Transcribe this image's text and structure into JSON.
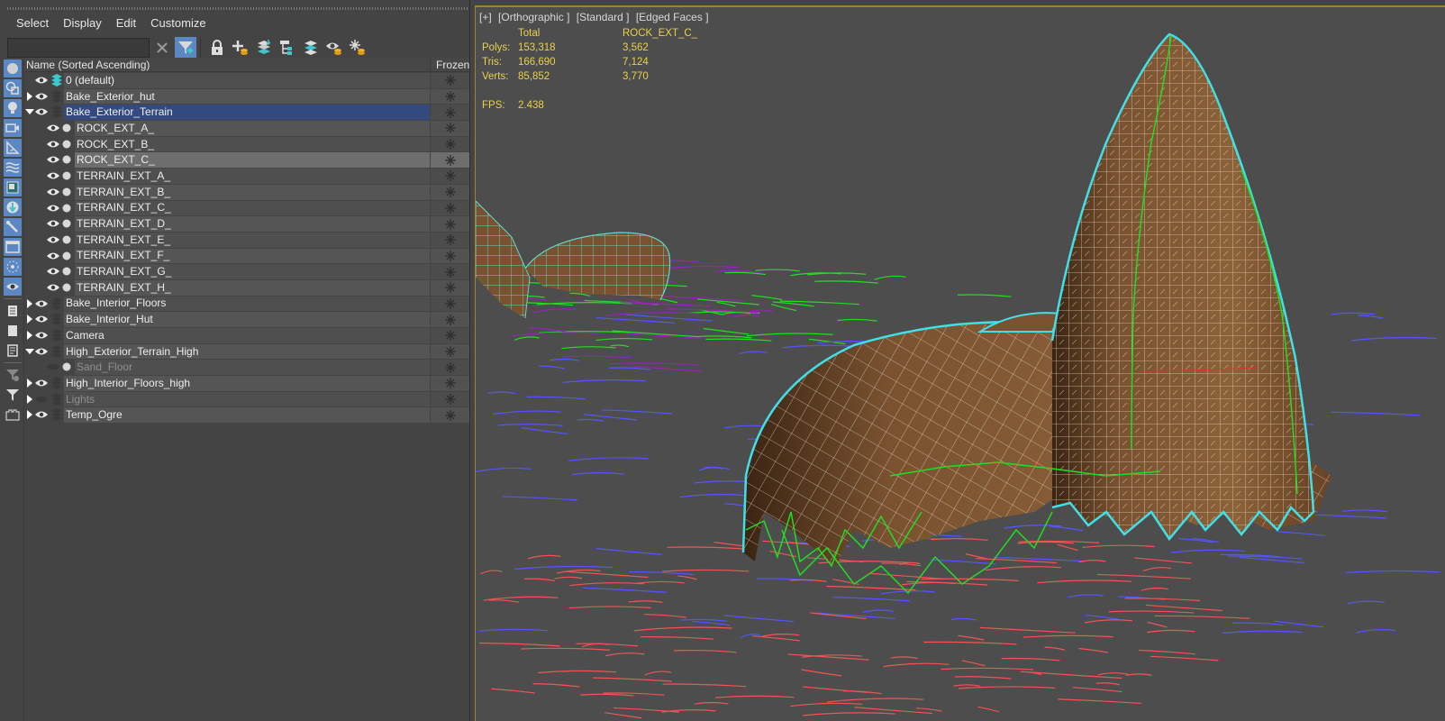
{
  "menubar": [
    "Select",
    "Display",
    "Edit",
    "Customize"
  ],
  "search": {
    "value": "",
    "placeholder": ""
  },
  "toolbar": {
    "buttons": [
      "clear-search-icon",
      "filter-toggle-icon",
      "lock-icon",
      "new-layer-icon",
      "add-to-layer-icon",
      "hierarchy-icon",
      "layers-icon",
      "hide-layer-icon",
      "freeze-layer-icon"
    ]
  },
  "side_strip": {
    "filters": [
      "geometry",
      "shapes",
      "lights",
      "cameras",
      "helpers",
      "space-warps",
      "groups",
      "xrefs",
      "bones",
      "containers",
      "particles",
      "visibility"
    ],
    "extras": [
      "display-children",
      "display-all",
      "display-references",
      "filter-settings",
      "filter",
      "container"
    ]
  },
  "tree": {
    "header": {
      "name": "Name (Sorted Ascending)",
      "frozen": "Frozen",
      "sort_icon": "sort-ascending-icon"
    },
    "rows": [
      {
        "name": "0 (default)",
        "level": 0,
        "expander": "none",
        "visible": true,
        "type": "default-layer",
        "state": ""
      },
      {
        "name": "Bake_Exterior_hut",
        "level": 0,
        "expander": "collapsed",
        "visible": true,
        "type": "layer",
        "state": ""
      },
      {
        "name": "Bake_Exterior_Terrain",
        "level": 0,
        "expander": "expanded",
        "visible": true,
        "type": "layer",
        "state": "selected"
      },
      {
        "name": "ROCK_EXT_A_",
        "level": 1,
        "expander": "none",
        "visible": true,
        "type": "object",
        "state": ""
      },
      {
        "name": "ROCK_EXT_B_",
        "level": 1,
        "expander": "none",
        "visible": true,
        "type": "object",
        "state": ""
      },
      {
        "name": "ROCK_EXT_C_",
        "level": 1,
        "expander": "none",
        "visible": true,
        "type": "object",
        "state": "highlighted"
      },
      {
        "name": "TERRAIN_EXT_A_",
        "level": 1,
        "expander": "none",
        "visible": true,
        "type": "object",
        "state": ""
      },
      {
        "name": "TERRAIN_EXT_B_",
        "level": 1,
        "expander": "none",
        "visible": true,
        "type": "object",
        "state": ""
      },
      {
        "name": "TERRAIN_EXT_C_",
        "level": 1,
        "expander": "none",
        "visible": true,
        "type": "object",
        "state": ""
      },
      {
        "name": "TERRAIN_EXT_D_",
        "level": 1,
        "expander": "none",
        "visible": true,
        "type": "object",
        "state": ""
      },
      {
        "name": "TERRAIN_EXT_E_",
        "level": 1,
        "expander": "none",
        "visible": true,
        "type": "object",
        "state": ""
      },
      {
        "name": "TERRAIN_EXT_F_",
        "level": 1,
        "expander": "none",
        "visible": true,
        "type": "object",
        "state": ""
      },
      {
        "name": "TERRAIN_EXT_G_",
        "level": 1,
        "expander": "none",
        "visible": true,
        "type": "object",
        "state": ""
      },
      {
        "name": "TERRAIN_EXT_H_",
        "level": 1,
        "expander": "none",
        "visible": true,
        "type": "object",
        "state": ""
      },
      {
        "name": "Bake_Interior_Floors",
        "level": 0,
        "expander": "collapsed",
        "visible": true,
        "type": "layer",
        "state": ""
      },
      {
        "name": "Bake_Interior_Hut",
        "level": 0,
        "expander": "collapsed",
        "visible": true,
        "type": "layer",
        "state": ""
      },
      {
        "name": "Camera",
        "level": 0,
        "expander": "collapsed",
        "visible": true,
        "type": "layer",
        "state": ""
      },
      {
        "name": "High_Exterior_Terrain_High",
        "level": 0,
        "expander": "expanded",
        "visible": true,
        "type": "layer",
        "state": ""
      },
      {
        "name": "Sand_Floor",
        "level": 1,
        "expander": "none",
        "visible": false,
        "type": "object",
        "state": "dim"
      },
      {
        "name": "High_Interior_Floors_high",
        "level": 0,
        "expander": "collapsed",
        "visible": true,
        "type": "layer",
        "state": ""
      },
      {
        "name": "Lights",
        "level": 0,
        "expander": "collapsed",
        "visible": false,
        "type": "layer",
        "state": "dim"
      },
      {
        "name": "Temp_Ogre",
        "level": 0,
        "expander": "collapsed",
        "visible": true,
        "type": "layer",
        "state": ""
      }
    ]
  },
  "viewport": {
    "labels": [
      "[+]",
      "[Orthographic ]",
      "[Standard ]",
      "[Edged Faces ]"
    ],
    "stats": {
      "col_total": "Total",
      "col_selected": "ROCK_EXT_C_",
      "rows": [
        {
          "key": "Polys:",
          "total": "153,318",
          "selected": "3,562"
        },
        {
          "key": "Tris:",
          "total": "166,690",
          "selected": "7,124"
        },
        {
          "key": "Verts:",
          "total": "85,852",
          "selected": "3,770"
        }
      ],
      "fps_label": "FPS:",
      "fps_value": "2.438"
    },
    "colors": {
      "accent_border": "#9c8530",
      "stats_text": "#e8d24a",
      "selection_outline": "#40e0e8",
      "rock_fill": "#7a5230",
      "wire_green": "#22dd22",
      "wire_blue": "#5555ff",
      "wire_red": "#ee5555",
      "wire_purple": "#9922bb"
    }
  }
}
